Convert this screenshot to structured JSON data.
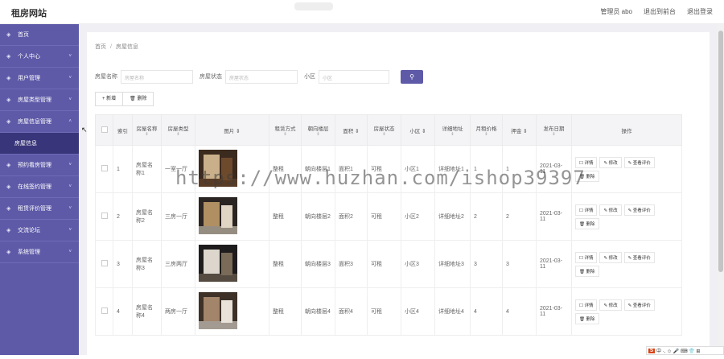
{
  "header": {
    "title": "租房网站",
    "user": "管理员 abo",
    "frontend": "退出到前台",
    "logout": "退出登录"
  },
  "sidebar": {
    "items": [
      {
        "label": "首页",
        "icon": "home-icon"
      },
      {
        "label": "个人中心",
        "icon": "user-icon"
      },
      {
        "label": "用户管理",
        "icon": "users-icon"
      },
      {
        "label": "房屋类型管理",
        "icon": "folder-icon"
      },
      {
        "label": "房屋信息管理",
        "icon": "house-icon"
      },
      {
        "label": "房屋信息",
        "sub": true
      },
      {
        "label": "预约看房管理",
        "icon": "calendar-icon"
      },
      {
        "label": "在线签约管理",
        "icon": "contract-icon"
      },
      {
        "label": "租赁评价管理",
        "icon": "comment-icon"
      },
      {
        "label": "交流论坛",
        "icon": "forum-icon"
      },
      {
        "label": "系统管理",
        "icon": "settings-icon"
      }
    ]
  },
  "breadcrumb": {
    "home": "首页",
    "sep": "/",
    "current": "房屋信息"
  },
  "search": {
    "name_label": "房屋名称",
    "name_placeholder": "房屋名称",
    "status_label": "房屋状态",
    "status_placeholder": "房屋状态",
    "area_label": "小区",
    "area_placeholder": "小区"
  },
  "actions": {
    "add": "+ 新增",
    "delete": "删除"
  },
  "table": {
    "headers": [
      "索引",
      "房屋名称",
      "房屋类型",
      "图片",
      "租赁方式",
      "朝向楼层",
      "面积",
      "房屋状态",
      "小区",
      "详细地址",
      "月租价格",
      "押金",
      "发布日期",
      "操作"
    ],
    "rows": [
      {
        "idx": "1",
        "name": "房屋名称1",
        "type": "一室一厅",
        "mode": "整租",
        "floor": "朝向楼层1",
        "area": "面积1",
        "status": "可租",
        "community": "小区1",
        "address": "详细地址1",
        "rent": "1",
        "deposit": "1",
        "date": "2021-03-11"
      },
      {
        "idx": "2",
        "name": "房屋名称2",
        "type": "三房一厅",
        "mode": "整租",
        "floor": "朝向楼层2",
        "area": "面积2",
        "status": "可租",
        "community": "小区2",
        "address": "详细地址2",
        "rent": "2",
        "deposit": "2",
        "date": "2021-03-11"
      },
      {
        "idx": "3",
        "name": "房屋名称3",
        "type": "三房两厅",
        "mode": "整租",
        "floor": "朝向楼层3",
        "area": "面积3",
        "status": "可租",
        "community": "小区3",
        "address": "详细地址3",
        "rent": "3",
        "deposit": "3",
        "date": "2021-03-11"
      },
      {
        "idx": "4",
        "name": "房屋名称4",
        "type": "两房一厅",
        "mode": "整租",
        "floor": "朝向楼层4",
        "area": "面积4",
        "status": "可租",
        "community": "小区4",
        "address": "详细地址4",
        "rent": "4",
        "deposit": "4",
        "date": "2021-03-11"
      }
    ],
    "op_detail": "详情",
    "op_edit": "修改",
    "op_review": "查看评价",
    "op_delete": "删除"
  },
  "watermark": "https://www.huzhan.com/ishop39397",
  "ime": {
    "brand": "S",
    "text": "中 ·, ☺ 🎤 ⌨ 👕 ⊞"
  },
  "colors": {
    "sidebar": "#5e5aa8",
    "accent": "#5e5aa8"
  }
}
